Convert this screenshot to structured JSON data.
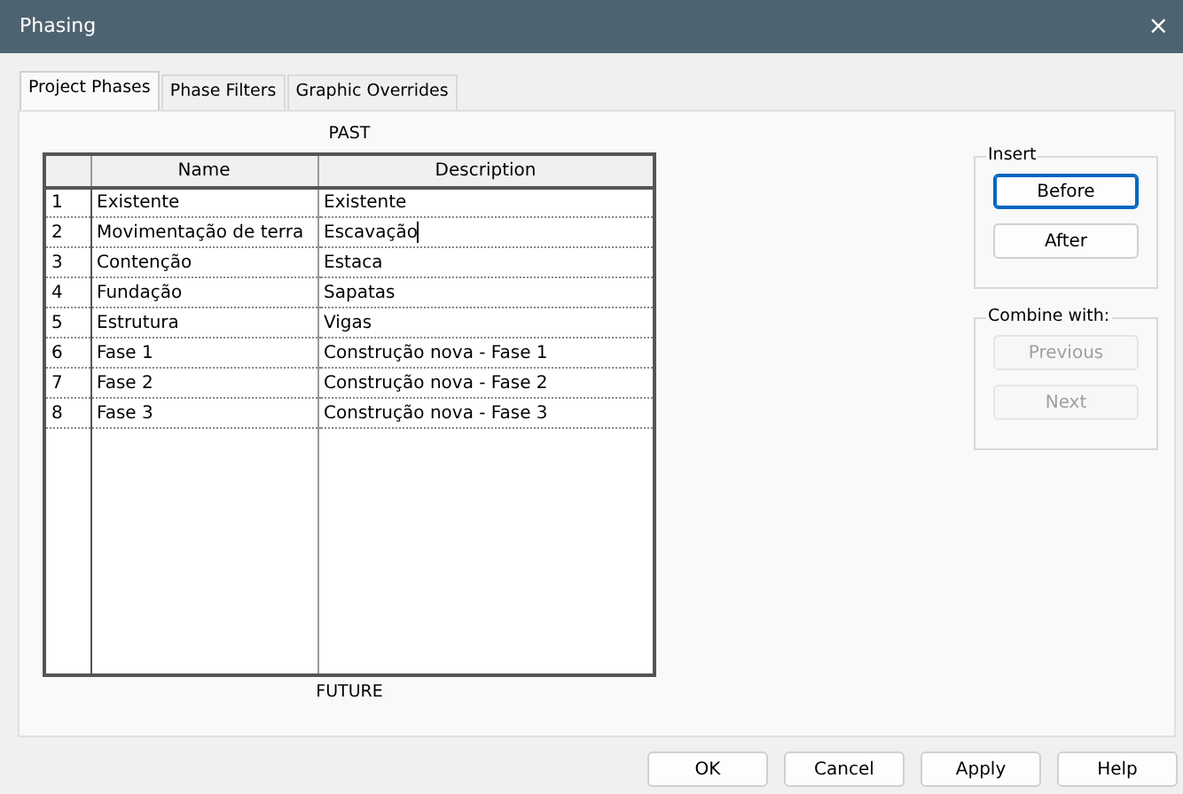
{
  "window": {
    "title": "Phasing",
    "close": "×"
  },
  "tabs": [
    {
      "label": "Project Phases",
      "selected": true
    },
    {
      "label": "Phase Filters",
      "selected": false
    },
    {
      "label": "Graphic Overrides",
      "selected": false
    }
  ],
  "past_label": "PAST",
  "future_label": "FUTURE",
  "table": {
    "columns": [
      "Name",
      "Description"
    ],
    "rows": [
      {
        "number": "1",
        "name": "Existente",
        "description": "Existente",
        "editing": false
      },
      {
        "number": "2",
        "name": "Movimentação de terra",
        "description": "Escavação",
        "editing": true
      },
      {
        "number": "3",
        "name": "Contenção",
        "description": "Estaca",
        "editing": false
      },
      {
        "number": "4",
        "name": "Fundação",
        "description": "Sapatas",
        "editing": false
      },
      {
        "number": "5",
        "name": "Estrutura",
        "description": "Vigas",
        "editing": false
      },
      {
        "number": "6",
        "name": "Fase 1",
        "description": "Construção nova - Fase 1",
        "editing": false
      },
      {
        "number": "7",
        "name": "Fase 2",
        "description": "Construção nova - Fase 2",
        "editing": false
      },
      {
        "number": "8",
        "name": "Fase 3",
        "description": "Construção nova - Fase 3",
        "editing": false
      }
    ]
  },
  "insert": {
    "legend": "Insert",
    "buttons": [
      {
        "label": "Before",
        "focused": true,
        "disabled": false
      },
      {
        "label": "After",
        "focused": false,
        "disabled": false
      }
    ]
  },
  "combine": {
    "legend": "Combine with:",
    "buttons": [
      {
        "label": "Previous",
        "focused": false,
        "disabled": true
      },
      {
        "label": "Next",
        "focused": false,
        "disabled": true
      }
    ]
  },
  "footer_buttons": [
    "OK",
    "Cancel",
    "Apply",
    "Help"
  ]
}
